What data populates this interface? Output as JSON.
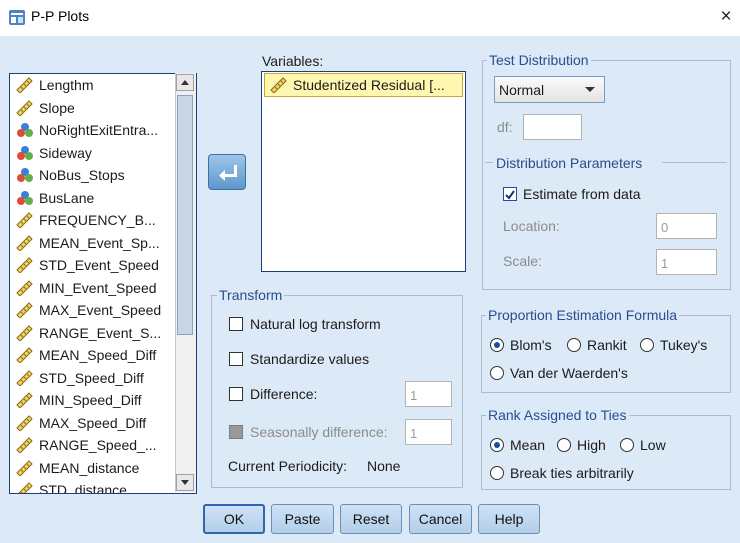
{
  "window": {
    "title": "P-P Plots",
    "close_glyph": "×"
  },
  "source_list": {
    "items": [
      {
        "label": "Lengthm",
        "icon": "ruler-icon"
      },
      {
        "label": "Slope",
        "icon": "ruler-icon"
      },
      {
        "label": "NoRightExitEntra...",
        "icon": "nominal-icon"
      },
      {
        "label": "Sideway",
        "icon": "nominal-icon"
      },
      {
        "label": "NoBus_Stops",
        "icon": "nominal-icon"
      },
      {
        "label": "BusLane",
        "icon": "nominal-icon"
      },
      {
        "label": "FREQUENCY_B...",
        "icon": "ruler-icon"
      },
      {
        "label": "MEAN_Event_Sp...",
        "icon": "ruler-icon"
      },
      {
        "label": "STD_Event_Speed",
        "icon": "ruler-icon"
      },
      {
        "label": "MIN_Event_Speed",
        "icon": "ruler-icon"
      },
      {
        "label": "MAX_Event_Speed",
        "icon": "ruler-icon"
      },
      {
        "label": "RANGE_Event_S...",
        "icon": "ruler-icon"
      },
      {
        "label": "MEAN_Speed_Diff",
        "icon": "ruler-icon"
      },
      {
        "label": "STD_Speed_Diff",
        "icon": "ruler-icon"
      },
      {
        "label": "MIN_Speed_Diff",
        "icon": "ruler-icon"
      },
      {
        "label": "MAX_Speed_Diff",
        "icon": "ruler-icon"
      },
      {
        "label": "RANGE_Speed_...",
        "icon": "ruler-icon"
      },
      {
        "label": "MEAN_distance",
        "icon": "ruler-icon"
      },
      {
        "label": "STD_distance",
        "icon": "ruler-icon"
      }
    ]
  },
  "variables": {
    "label": "Variables:",
    "items": [
      {
        "label": "Studentized Residual [...",
        "icon": "ruler-icon"
      }
    ]
  },
  "test_distribution": {
    "title": "Test Distribution",
    "selected": "Normal",
    "df_label": "df:",
    "df_value": "",
    "params_title": "Distribution Parameters",
    "estimate_label": "Estimate from data",
    "estimate_checked": true,
    "location_label": "Location:",
    "location_value": "0",
    "scale_label": "Scale:",
    "scale_value": "1"
  },
  "transform": {
    "title": "Transform",
    "natural_log": "Natural log transform",
    "standardize": "Standardize values",
    "difference": "Difference:",
    "difference_value": "1",
    "seasonal": "Seasonally difference:",
    "seasonal_value": "1",
    "periodicity_label": "Current Periodicity:",
    "periodicity_value": "None"
  },
  "proportion": {
    "title": "Proportion Estimation Formula",
    "options": [
      "Blom's",
      "Rankit",
      "Tukey's",
      "Van der Waerden's"
    ],
    "selected": "Blom's"
  },
  "ties": {
    "title": "Rank Assigned to Ties",
    "options": [
      "Mean",
      "High",
      "Low",
      "Break ties arbitrarily"
    ],
    "selected": "Mean"
  },
  "buttons": {
    "ok": "OK",
    "paste": "Paste",
    "reset": "Reset",
    "cancel": "Cancel",
    "help": "Help"
  },
  "colors": {
    "client_bg": "#dce9f6",
    "group_title": "#2a4d8f",
    "accent": "#2f66b0",
    "selected_var_bg": "#fff7b0"
  }
}
